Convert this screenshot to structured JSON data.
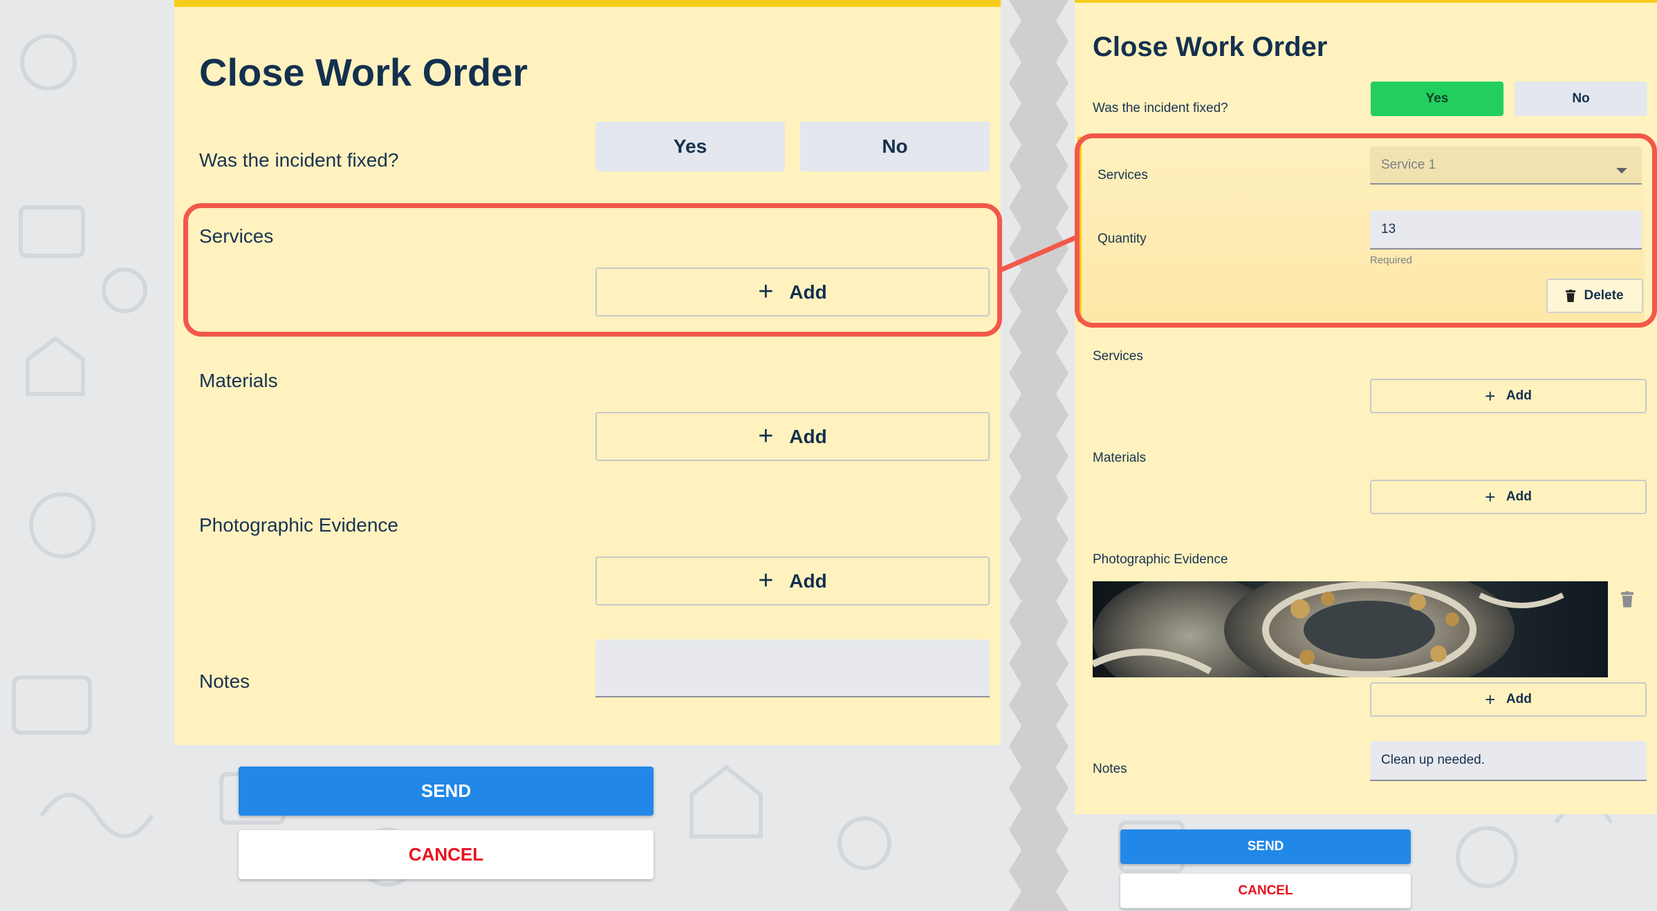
{
  "left": {
    "title": "Close Work Order",
    "incident_question": "Was the incident fixed?",
    "yes_label": "Yes",
    "no_label": "No",
    "services_label": "Services",
    "materials_label": "Materials",
    "photo_label": "Photographic Evidence",
    "notes_label": "Notes",
    "add_label": "Add",
    "notes_value": "",
    "send_label": "SEND",
    "cancel_label": "CANCEL"
  },
  "right": {
    "title": "Close Work Order",
    "incident_question": "Was the incident fixed?",
    "yes_label": "Yes",
    "no_label": "No",
    "yes_selected": true,
    "service_entry": {
      "services_label": "Services",
      "service_select_value": "Service 1",
      "quantity_label": "Quantity",
      "quantity_value": "13",
      "quantity_helper": "Required",
      "delete_label": "Delete"
    },
    "services_label": "Services",
    "materials_label": "Materials",
    "photo_label": "Photographic Evidence",
    "notes_label": "Notes",
    "add_label": "Add",
    "notes_value": "Clean up needed.",
    "send_label": "SEND",
    "cancel_label": "CANCEL"
  },
  "colors": {
    "panel_bg": "#fff2bf",
    "accent_yellow": "#f6cc1a",
    "highlight_red": "#f2584a",
    "yes_green": "#22cf5d",
    "send_blue": "#2188e8",
    "cancel_red": "#e8121e",
    "title_navy": "#14304f"
  },
  "icons": {
    "add": "plus-icon",
    "delete": "trash-icon",
    "select": "caret-down-icon"
  }
}
